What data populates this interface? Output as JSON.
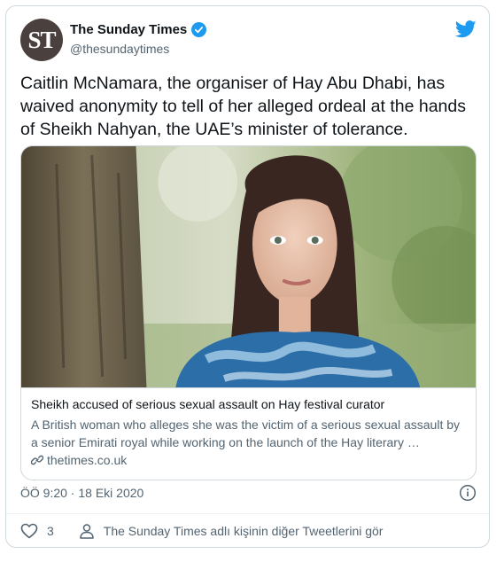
{
  "author": {
    "avatar_text": "ST",
    "name": "The Sunday Times",
    "handle": "@thesundaytimes"
  },
  "tweet": {
    "text": "Caitlin McNamara, the organiser of Hay Abu Dhabi, has waived anonymity to tell of her alleged ordeal at the hands of Sheikh Nahyan, the UAE’s minister of tolerance."
  },
  "link_card": {
    "title": "Sheikh accused of serious sexual assault on Hay festival curator",
    "description": "A British woman who alleges she was the victim of a serious sexual assault by a senior Emirati royal while working on the launch of the Hay literary …",
    "domain": "thetimes.co.uk"
  },
  "meta": {
    "timestamp": "ÖÖ 9:20 · 18 Eki 2020"
  },
  "actions": {
    "like_count": "3",
    "more_tweets": "The Sunday Times adlı kişinin diğer Tweetlerini gör"
  },
  "colors": {
    "twitter_blue": "#1d9bf0",
    "secondary_text": "#536471",
    "border": "#cfd9de"
  },
  "icons": [
    "twitter-bird-icon",
    "verified-badge-icon",
    "link-icon",
    "info-icon",
    "heart-icon",
    "person-icon"
  ]
}
